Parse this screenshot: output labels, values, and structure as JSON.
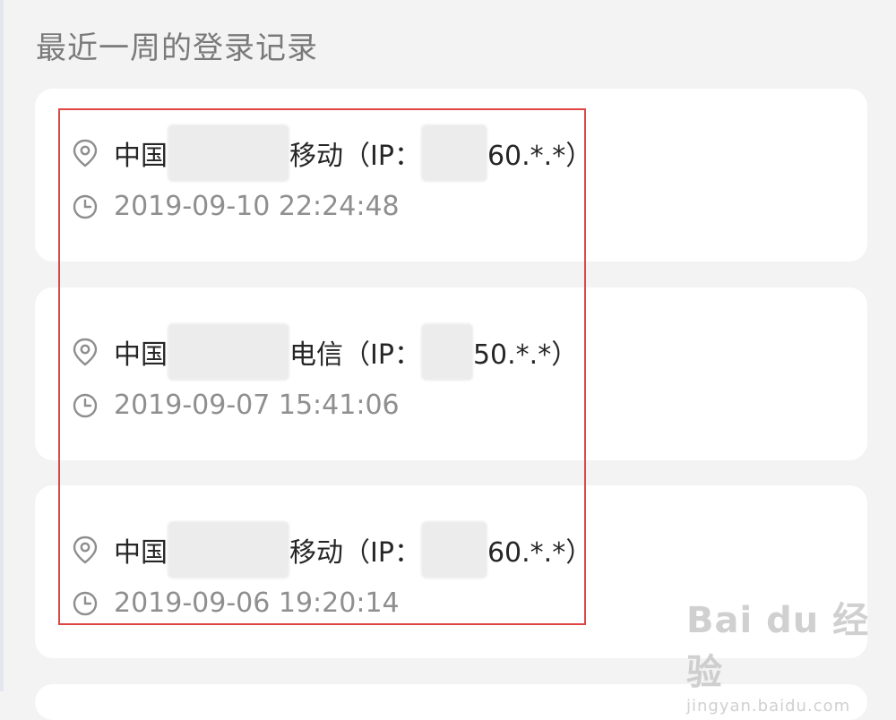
{
  "header": {
    "title": "最近一周的登录记录"
  },
  "records": [
    {
      "country": "中国",
      "carrier": "移动（IP：",
      "ip_tail": "60.*.*）",
      "time": "2019-09-10 22:24:48"
    },
    {
      "country": "中国",
      "carrier": "电信（IP：",
      "ip_tail": "50.*.*）",
      "time": "2019-09-07 15:41:06"
    },
    {
      "country": "中国",
      "carrier": "移动（IP：",
      "ip_tail": "60.*.*）",
      "time": "2019-09-06 19:20:14"
    }
  ],
  "icons": {
    "location": "location-pin-icon",
    "time": "clock-icon"
  },
  "colors": {
    "background": "#f3f3f3",
    "card": "#ffffff",
    "highlight": "#e04545"
  },
  "watermark": {
    "brand": "Bai du 经验",
    "url": "jingyan.baidu.com"
  }
}
